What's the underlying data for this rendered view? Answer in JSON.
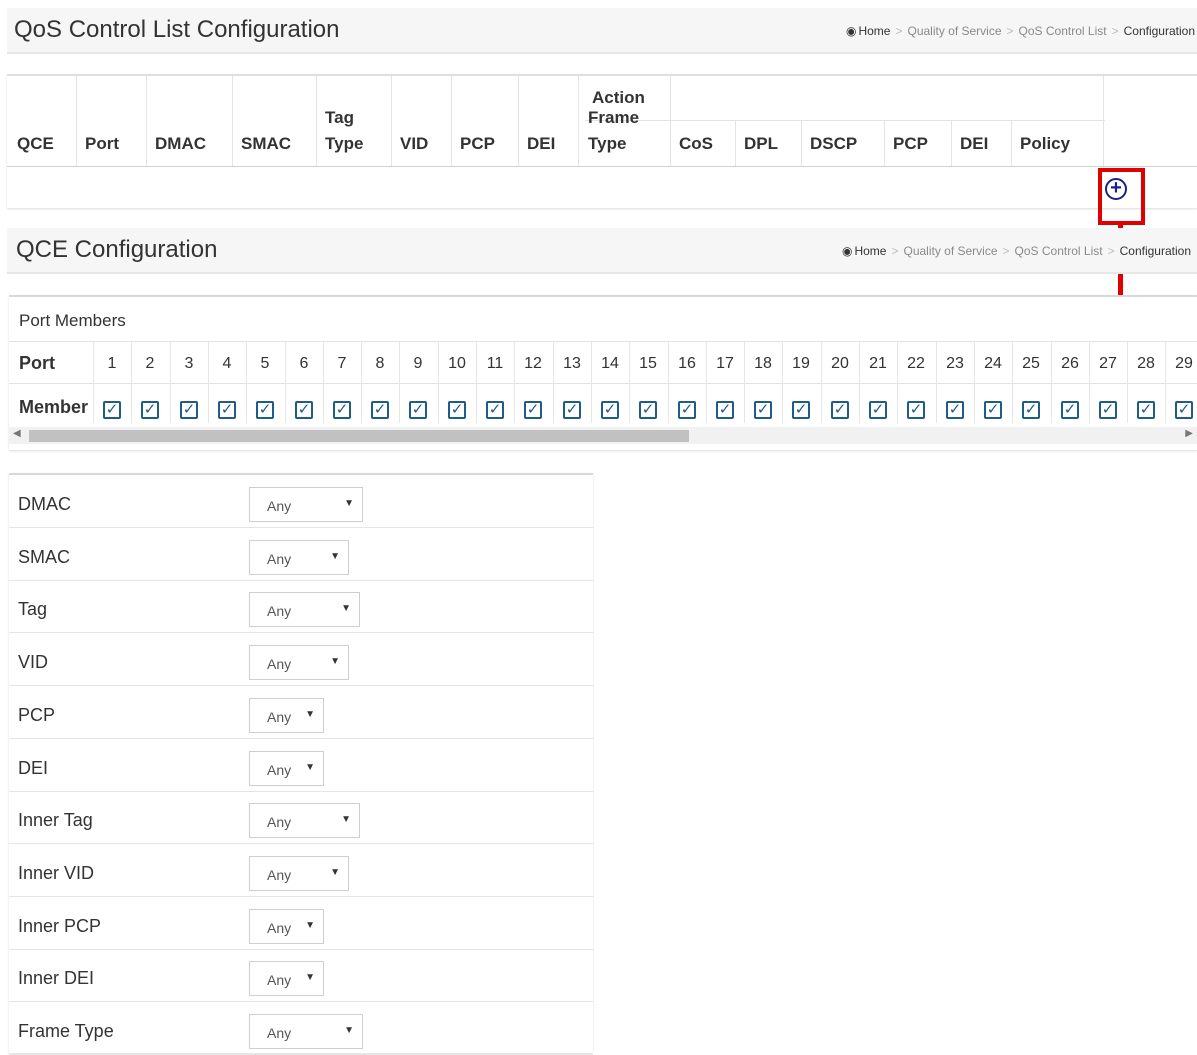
{
  "list_header": {
    "title": "QoS Control List Configuration",
    "breadcrumb": {
      "home": "Home",
      "items": [
        "Quality of Service",
        "QoS Control List"
      ],
      "current": "Configuration"
    }
  },
  "list_table": {
    "action_group": "Action",
    "columns": {
      "qce": "QCE",
      "port": "Port",
      "dmac": "DMAC",
      "smac": "SMAC",
      "tag_type_1": "Tag",
      "tag_type_2": "Type",
      "vid": "VID",
      "pcp": "PCP",
      "dei": "DEI",
      "frame_type_1": "Frame",
      "frame_type_2": "Type",
      "cos": "CoS",
      "dpl": "DPL",
      "dscp": "DSCP",
      "a_pcp": "PCP",
      "a_dei": "DEI",
      "policy": "Policy"
    },
    "add_icon": "plus-circle-icon"
  },
  "qce_header": {
    "title": "QCE Configuration",
    "breadcrumb": {
      "home": "Home",
      "items": [
        "Quality of Service",
        "QoS Control List"
      ],
      "current": "Configuration"
    }
  },
  "port_members": {
    "title": "Port Members",
    "port_label": "Port",
    "member_label": "Member",
    "ports": [
      "1",
      "2",
      "3",
      "4",
      "5",
      "6",
      "7",
      "8",
      "9",
      "10",
      "11",
      "12",
      "13",
      "14",
      "15",
      "16",
      "17",
      "18",
      "19",
      "20",
      "21",
      "22",
      "23",
      "24",
      "25",
      "26",
      "27",
      "28",
      "29"
    ],
    "checked": true
  },
  "form": {
    "rows": [
      {
        "label": "DMAC",
        "value": "Any"
      },
      {
        "label": "SMAC",
        "value": "Any"
      },
      {
        "label": "Tag",
        "value": "Any"
      },
      {
        "label": "VID",
        "value": "Any"
      },
      {
        "label": "PCP",
        "value": "Any"
      },
      {
        "label": "DEI",
        "value": "Any"
      },
      {
        "label": "Inner Tag",
        "value": "Any"
      },
      {
        "label": "Inner VID",
        "value": "Any"
      },
      {
        "label": "Inner PCP",
        "value": "Any"
      },
      {
        "label": "Inner DEI",
        "value": "Any"
      },
      {
        "label": "Frame Type",
        "value": "Any"
      }
    ]
  },
  "colors": {
    "annotation": "#e00000",
    "checkbox": "#1f5d86",
    "add_icon": "#1b1f8f"
  }
}
